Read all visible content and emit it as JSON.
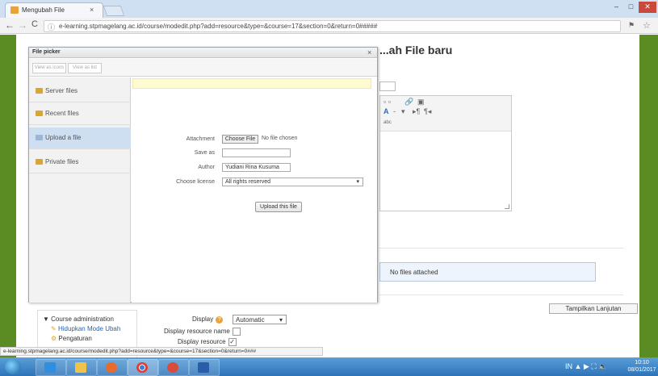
{
  "browser": {
    "tab_title": "Mengubah File",
    "tab_close": "×",
    "url": "e-learning.stpmagelang.ac.id/course/modedit.php?add=resource&type=&course=17&section=0&return=0#####",
    "url_prefix": "ⓘ",
    "window_controls": {
      "minimize": "–",
      "maximize": "□",
      "close": "✕"
    }
  },
  "page": {
    "heading": "...ah File baru",
    "files_box_text": "No files attached",
    "advanced_link": "Tampilkan Lanjutan",
    "display_label": "Display",
    "display_value": "Automatic",
    "display_name_label": "Display resource name",
    "display_desc_label": "Display resource",
    "course_admin": "Course administration",
    "mode_link": "Hidupkan Mode Ubah",
    "settings_link": "Pengaturan"
  },
  "file_picker": {
    "title": "File picker",
    "close": "×",
    "view_buttons": [
      "View as icons",
      "View as list"
    ],
    "repositories": [
      {
        "label": "Server files"
      },
      {
        "label": "Recent files"
      },
      {
        "label": "Upload a file"
      },
      {
        "label": "Private files"
      }
    ],
    "form": {
      "attachment_label": "Attachment",
      "choose_button": "Choose File",
      "no_file_text": "No file chosen",
      "saveas_label": "Save as",
      "saveas_value": "",
      "author_label": "Author",
      "author_value": "Yudiani Rina Kusuma",
      "license_label": "Choose license",
      "license_value": "All rights reserved",
      "upload_button": "Upload this file"
    }
  },
  "status_bar_url": "e-learning.stpmagelang.ac.id/course/modedit.php?add=resource&type=&course=17&section=0&return=0###",
  "taskbar": {
    "tray_text": "IN ▲ ▶ ⛶ 🔈",
    "time": "10:10",
    "date": "08/01/2017"
  }
}
